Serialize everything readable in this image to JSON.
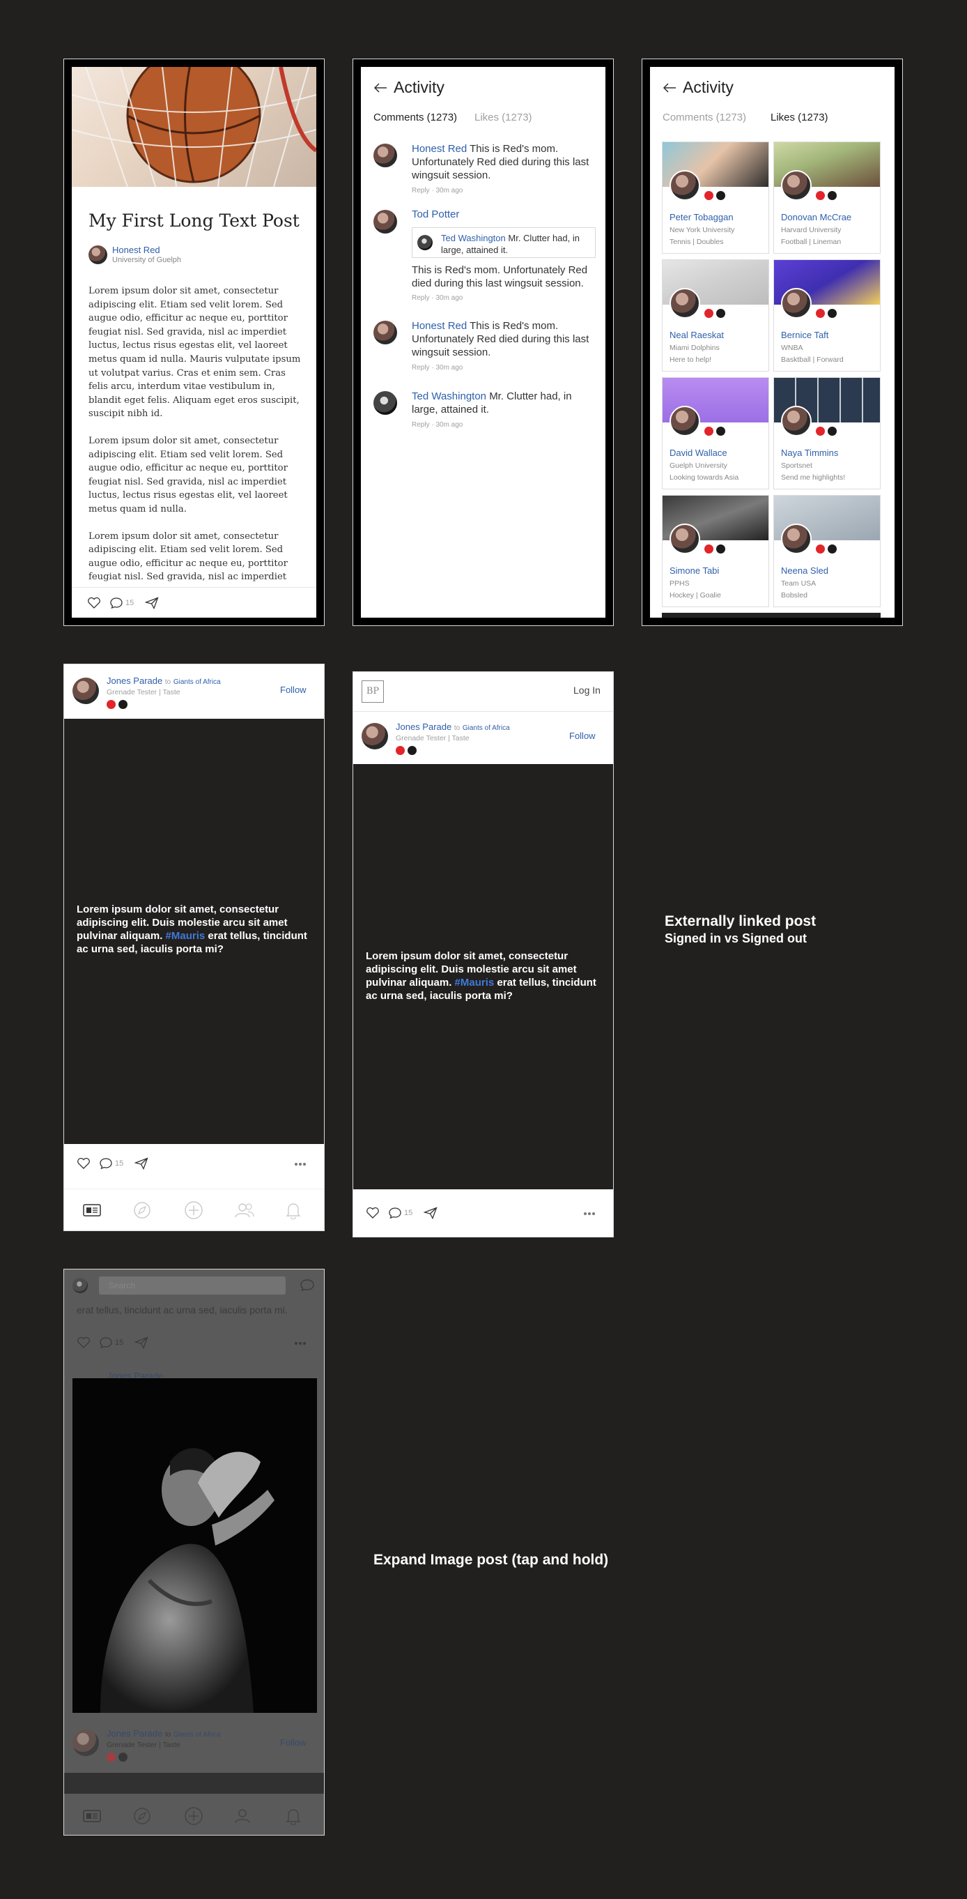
{
  "longpost": {
    "title": "My First Long Text Post",
    "author": "Honest Red",
    "school": "University of Guelph",
    "paragraphs": [
      "Lorem ipsum dolor sit amet, consectetur adipiscing elit. Etiam sed velit lorem. Sed augue odio, efficitur ac neque eu, porttitor feugiat nisl. Sed gravida, nisl ac imperdiet luctus, lectus risus egestas elit, vel laoreet metus quam id nulla. Mauris vulputate ipsum ut volutpat varius. Cras et enim sem. Cras felis arcu, interdum vitae vestibulum in, blandit eget felis. Aliquam eget eros suscipit, suscipit nibh id.",
      "Lorem ipsum dolor sit amet, consectetur adipiscing elit. Etiam sed velit lorem. Sed augue odio, efficitur ac neque eu, porttitor feugiat nisl. Sed gravida, nisl ac imperdiet luctus, lectus risus egestas elit, vel laoreet metus quam id nulla.",
      "Lorem ipsum dolor sit amet, consectetur adipiscing elit. Etiam sed velit lorem. Sed augue odio, efficitur ac neque eu, porttitor feugiat nisl. Sed gravida, nisl ac imperdiet"
    ],
    "comment_count": "15"
  },
  "activity_comments": {
    "title": "Activity",
    "tab_comments": "Comments (1273)",
    "tab_likes": "Likes (1273)",
    "comments": [
      {
        "name": "Honest Red",
        "text": "This is Red's mom. Unfortunately Red died during this last wingsuit session.",
        "meta": "Reply · 30m ago"
      },
      {
        "name": "Tod Potter",
        "quote_name": "Ted Washington",
        "quote_text": "Mr. Clutter had, in large, attained it.",
        "text": "This is Red's mom. Unfortunately Red died during this last wingsuit session.",
        "meta": "Reply · 30m ago"
      },
      {
        "name": "Honest Red",
        "text": "This is Red's mom. Unfortunately Red died during this last wingsuit session.",
        "meta": "Reply · 30m ago"
      },
      {
        "name": "Ted Washington",
        "text": "Mr. Clutter had, in large, attained it.",
        "meta": "Reply · 30m ago"
      }
    ]
  },
  "activity_likes": {
    "title": "Activity",
    "tab_comments": "Comments (1273)",
    "tab_likes": "Likes (1273)",
    "cards": [
      {
        "name": "Peter Tobaggan",
        "l1": "New York University",
        "l2": "Tennis | Doubles"
      },
      {
        "name": "Donovan McCrae",
        "l1": "Harvard University",
        "l2": "Football | Lineman"
      },
      {
        "name": "Neal Raeskat",
        "l1": "Miami Dolphins",
        "l2": "Here to help!"
      },
      {
        "name": "Bernice Taft",
        "l1": "WNBA",
        "l2": "Basktball | Forward"
      },
      {
        "name": "David Wallace",
        "l1": "Guelph University",
        "l2": "Looking towards Asia"
      },
      {
        "name": "Naya Timmins",
        "l1": "Sportsnet",
        "l2": "Send me highlights!"
      },
      {
        "name": "Simone Tabi",
        "l1": "PPHS",
        "l2": "Hockey | Goalie"
      },
      {
        "name": "Neena Sled",
        "l1": "Team USA",
        "l2": "Bobsled"
      }
    ]
  },
  "textpost": {
    "author": "Jones Parade",
    "to": "to",
    "group": "Giants of Africa",
    "sub": "Grenade Tester | Taste",
    "follow": "Follow",
    "body_before": "Lorem ipsum dolor sit amet, consectetur adipiscing elit. Duis molestie arcu sit amet pulvinar aliquam. ",
    "hashtag": "#Mauris",
    "body_after": " erat tellus, tincidunt ac urna sed, iaculis porta mi?",
    "comment_count": "15"
  },
  "external": {
    "logo": "BP",
    "login": "Log In"
  },
  "expand": {
    "search_placeholder": "Search",
    "snippet": "erat tellus, tincidunt ac urna sed, iaculis porta mi.",
    "comment_count": "15",
    "author": "Jones Parade",
    "to": "to",
    "group": "Giants of Africa",
    "sub": "Grenade Tester | Taste",
    "follow": "Follow"
  },
  "captions": {
    "external_title": "Externally linked post",
    "external_sub": "Signed in vs Signed out",
    "expand": "Expand Image post (tap and hold)"
  }
}
